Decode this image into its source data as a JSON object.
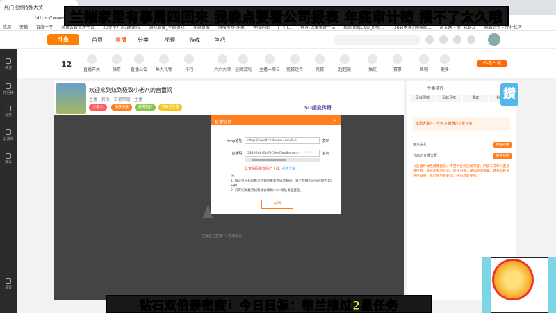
{
  "browser": {
    "tab_title": "热门视频特殊大奖",
    "url": "https://www.T",
    "bookmarks": [
      "应用",
      "天猫",
      "百度一下",
      "斗鱼公告管理平台",
      "20岁不打游戏Kuma",
      "游戏直播_全部游戏",
      "斗鱼直播",
      "博播放器-斗鱼",
      "神情地图",
      "[ 飞 ]...",
      "抖音-记录美好生活",
      "RunningOvO_的微...",
      "(38封未读) 网易邮...",
      "淘宝网 - 淘! 我喜欢",
      "精致好生 - 虎扑社区"
    ]
  },
  "overlay": {
    "top_banner": "兰摧家里有事周四回来 我晚点要看公司报表 年底审计辣 播不了太久哦",
    "bottom_banner": "钻石双倍亲密度！今日目标：帮兰摧过2星任务"
  },
  "header": {
    "logo": "斗鱼",
    "nav": [
      "首页",
      "直播",
      "分类",
      "视频",
      "游戏",
      "鱼吧"
    ],
    "active_nav": "直播"
  },
  "sidebar": {
    "items": [
      "关注",
      "排行榜",
      "分类",
      "云游戏",
      "赛事"
    ],
    "bottom": "设置"
  },
  "categories": {
    "count": "12",
    "items": [
      "主播开播",
      "直播开关",
      "弹幕",
      "直播公告",
      "鱼丸礼物",
      "排行",
      "六六大顺",
      "全民游戏",
      "主播一周日",
      "竞猜组合",
      "竞猜",
      "超越限",
      "抽奖",
      "赛事",
      "鱼吧",
      "更多"
    ],
    "pc_button": "PC客户端"
  },
  "room": {
    "title": "欢迎来到炫到极致小老八的直播间",
    "sub": "主播 · 其他 · 王者荣耀 · 主播",
    "pills": [
      "小老八",
      "播放加速",
      "获得钻石",
      "前两月主播"
    ],
    "player_caption": "主播正在直播中, 感谢观看",
    "watermark": "SD超变传奇"
  },
  "modal": {
    "title": "直播信息",
    "rtmp_label": "rtmp地址:",
    "rtmp_value": "rtmp://sendtc3.douyu.com/live",
    "key_label": "直播码:",
    "key_value": "5319286rDeT6CUedTwoSecret= ********",
    "copy": "复制",
    "warning": "此直播码推流后已上线, ",
    "warning_link": "点这了解",
    "note_title": "注:",
    "notes": [
      "1. 每次点击获取推流后都会重新生成直播码，每个直播码的有效期为15分钟。",
      "2. 只有切换推流线路才会导致rtmp地址发生变化。"
    ],
    "confirm": "关闭"
  },
  "right_panel": {
    "header": "主播排行",
    "tabs": [
      "贡献周榜",
      "贡献月榜",
      "贵宾",
      "粉丝团"
    ],
    "event": "本周大事件 · 今天·主播通过了星任务",
    "ranks": [
      {
        "name": "鱼丸生礼",
        "btn": "赠送礼物"
      },
      {
        "name": "开启正直播大赛",
        "btn": "赠送礼物"
      }
    ],
    "notice": "斗鱼倡导绿色健康直播，不提供任何违规内容。严禁未成年人直播或打赏。请适度参与互动，理性消费，谨防网络诈骗。遇到问题请点击举报，我们将尽快处理，感谢您的支持。"
  }
}
